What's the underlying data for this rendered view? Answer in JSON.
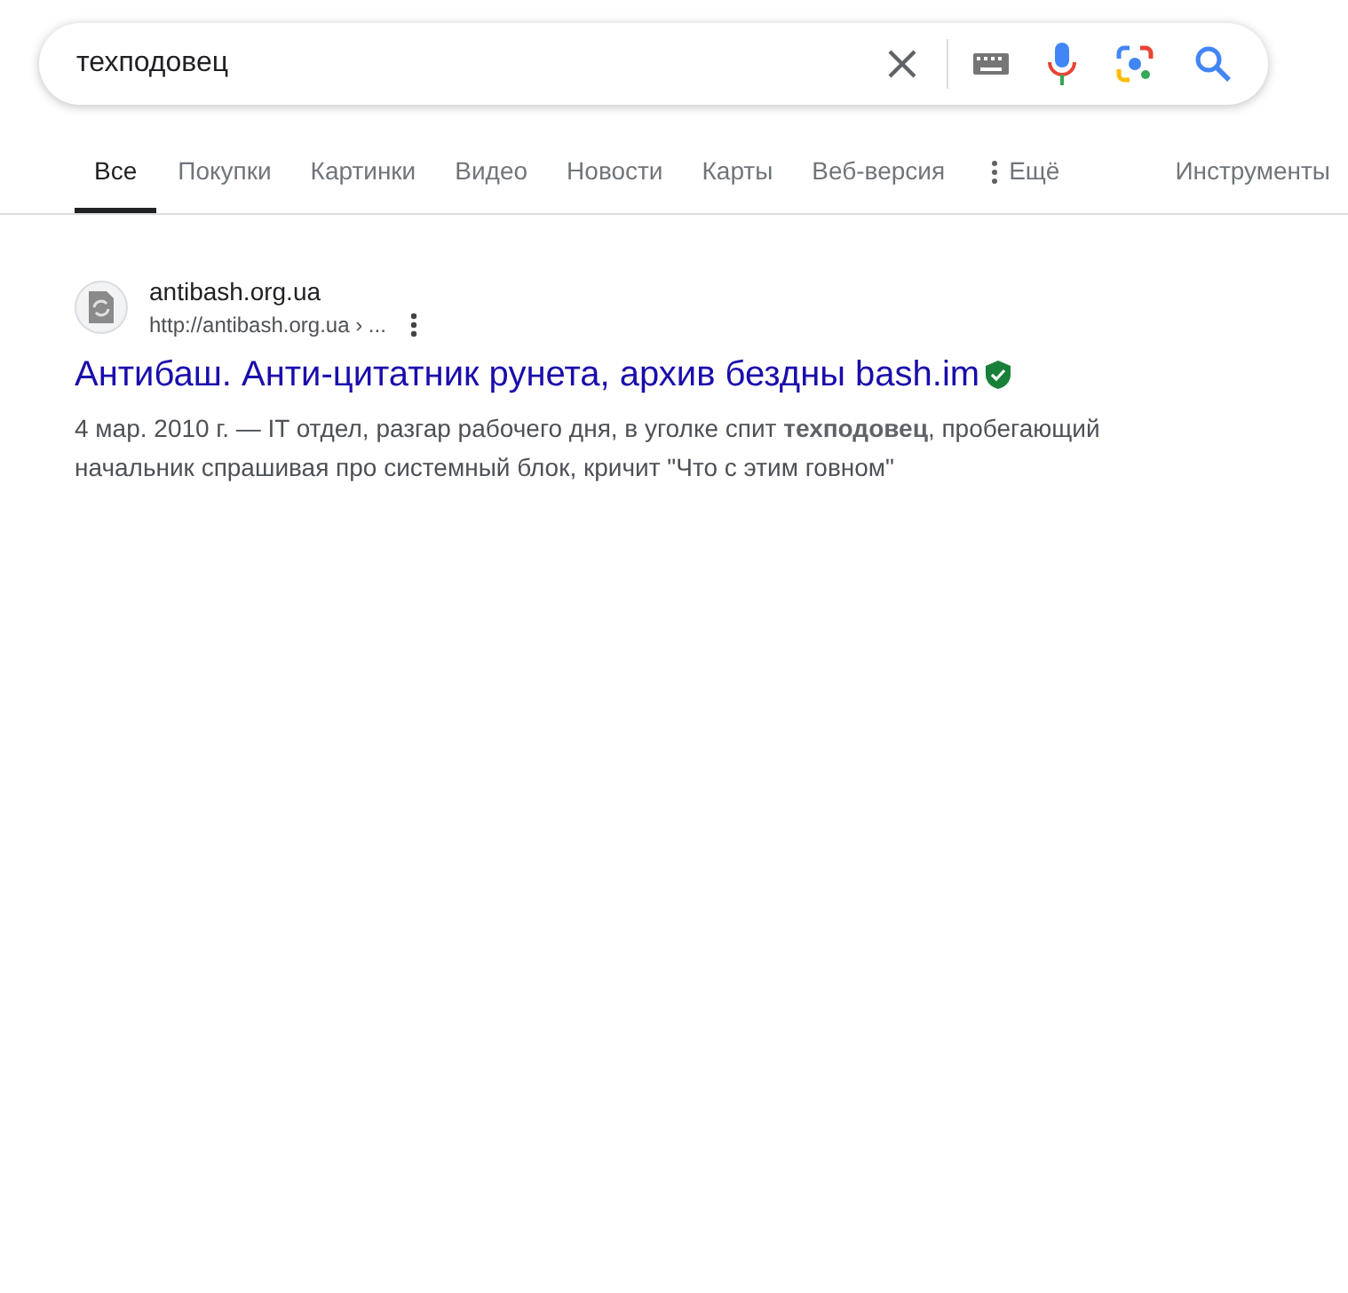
{
  "search": {
    "value": "техподовец"
  },
  "tabs": [
    {
      "label": "Все",
      "selected": true
    },
    {
      "label": "Покупки",
      "selected": false
    },
    {
      "label": "Картинки",
      "selected": false
    },
    {
      "label": "Видео",
      "selected": false
    },
    {
      "label": "Новости",
      "selected": false
    },
    {
      "label": "Карты",
      "selected": false
    },
    {
      "label": "Веб-версия",
      "selected": false
    },
    {
      "label": "Ещё",
      "selected": false
    }
  ],
  "tools": "Инструменты",
  "results": [
    {
      "site": "antibash.org.ua",
      "url": "http://antibash.org.ua › ...",
      "title": "Антибаш. Анти-цитатник рунета, архив бездны bash.im",
      "verified": true,
      "snippet": "4 мар. 2010 г. — IT отдел, разгар рабочего дня, в уголке спит **техподовец**, пробегающий начальник спрашивая про системный блок, кричит \"Что с этим говном\""
    }
  ]
}
